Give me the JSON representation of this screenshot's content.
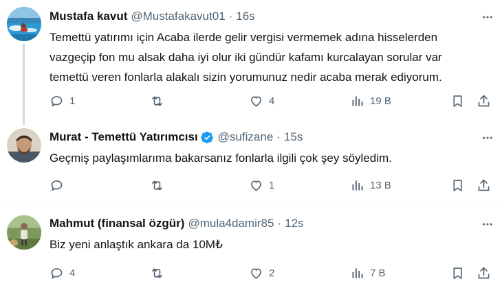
{
  "tweets": [
    {
      "name": "Mustafa kavut",
      "handle": "@Mustafakavut01",
      "time": "16s",
      "text_lines": [
        "Temettü yatırımı için Acaba ilerde gelir vergisi vermemek adına hisselerden",
        "vazgeçip fon mu alsak daha iyi olur iki gündür kafamı kurcalayan sorular var",
        "temettü veren fonlarla alakalı sizin yorumunuz nedir acaba merak ediyorum."
      ],
      "replies": "1",
      "retweets": "",
      "likes": "4",
      "views": "19 B"
    },
    {
      "name": "Murat - Temettü Yatırımcısı",
      "handle": "@sufizane",
      "time": "15s",
      "verified": true,
      "text_lines": [
        "Geçmiş paylaşımlarıma bakarsanız fonlarla ilgili çok şey söyledim."
      ],
      "replies": "",
      "retweets": "",
      "likes": "1",
      "views": "13 B"
    },
    {
      "name": "Mahmut (finansal özgür)",
      "handle": "@mula4damir85",
      "time": "12s",
      "text_lines": [
        "Biz yeni anlaştık ankara da 10M₺"
      ],
      "replies": "4",
      "retweets": "",
      "likes": "2",
      "views": "7 B"
    }
  ],
  "icons": {
    "reply": "reply-icon",
    "retweet": "retweet-icon",
    "like": "heart-icon",
    "views": "views-icon",
    "bookmark": "bookmark-icon",
    "share": "share-icon",
    "more": "more-icon",
    "verified": "verified-badge-icon"
  },
  "colors": {
    "text": "#0f1419",
    "secondary": "#536471",
    "verified_blue": "#1d9bf0",
    "divider": "#eff3f4",
    "thread_line": "#cfd9de"
  }
}
